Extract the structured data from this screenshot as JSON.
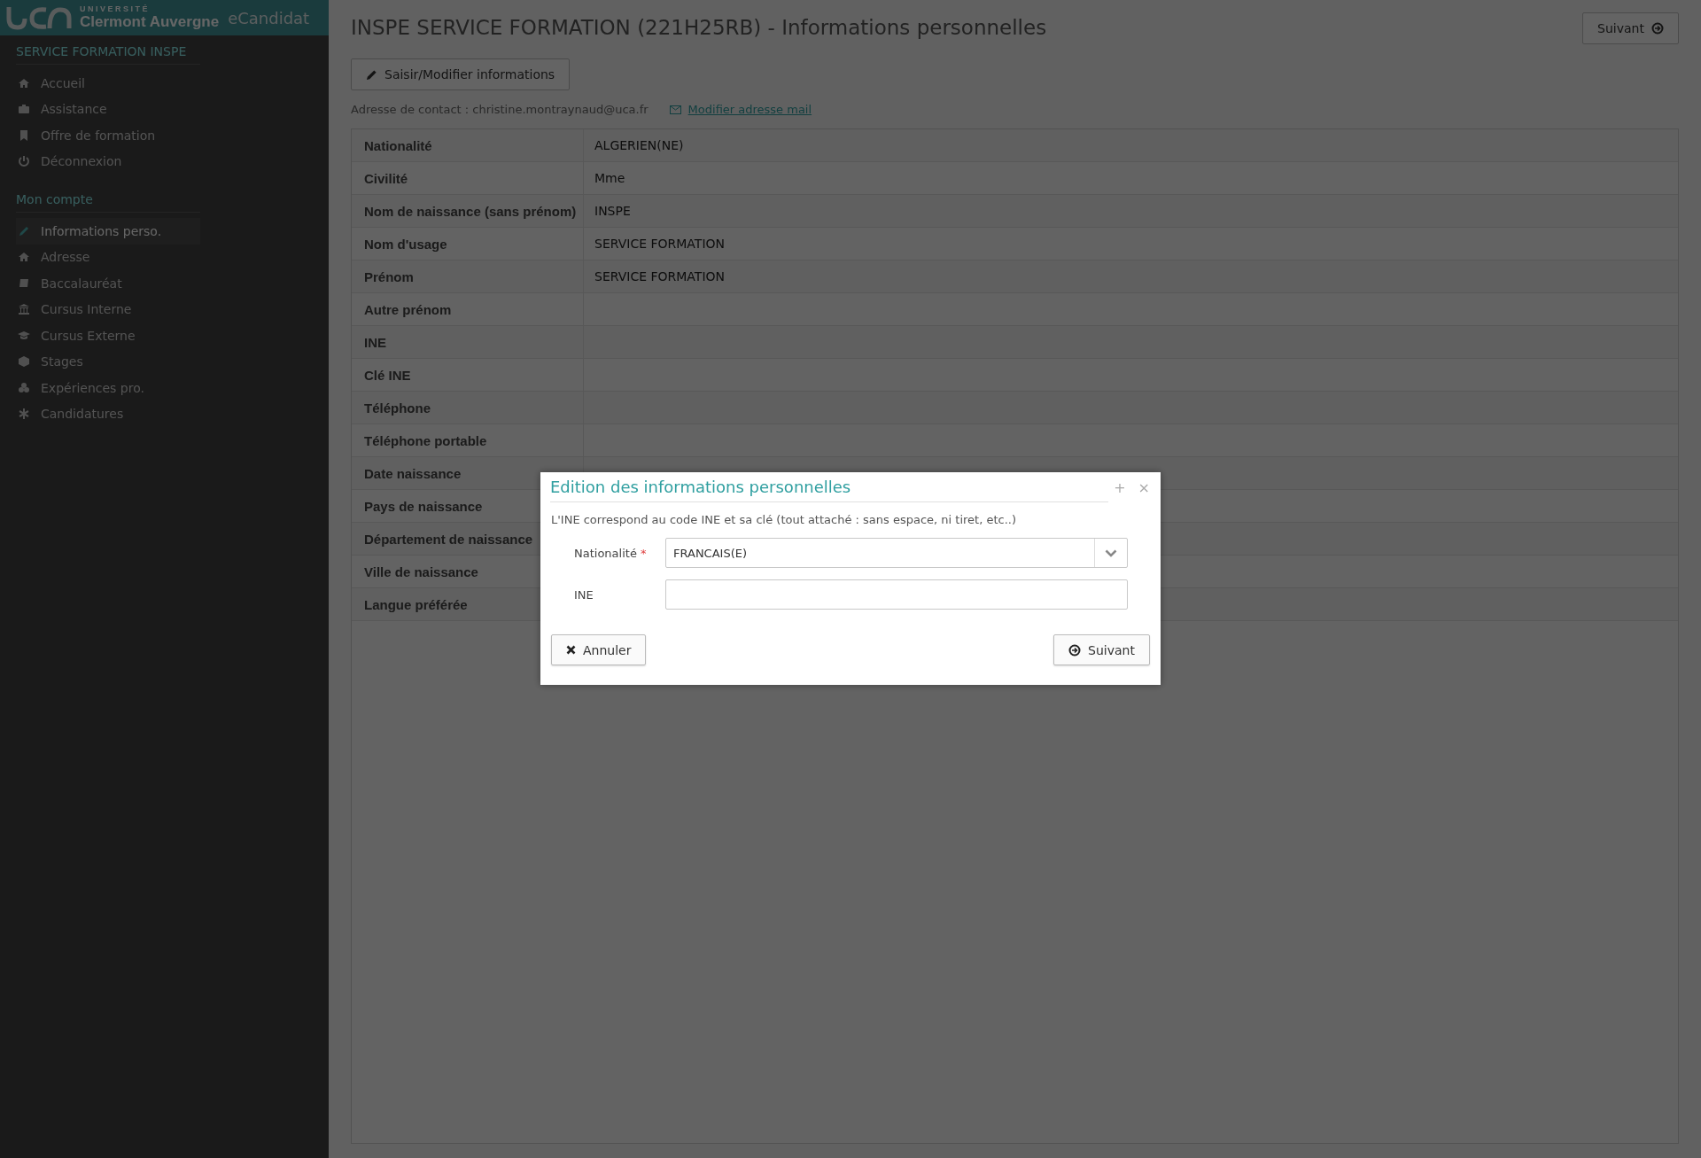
{
  "header": {
    "university_small": "UNIVERSITÉ",
    "university": "Clermont Auvergne",
    "app_name": "eCandidat"
  },
  "sidebar": {
    "sections": [
      {
        "title": "SERVICE FORMATION INSPE",
        "items": [
          {
            "label": "Accueil",
            "selected": false
          },
          {
            "label": "Assistance",
            "selected": false
          },
          {
            "label": "Offre de formation",
            "selected": false
          },
          {
            "label": "Déconnexion",
            "selected": false
          }
        ]
      },
      {
        "title": "Mon compte",
        "items": [
          {
            "label": "Informations perso.",
            "selected": true
          },
          {
            "label": "Adresse",
            "selected": false
          },
          {
            "label": "Baccalauréat",
            "selected": false
          },
          {
            "label": "Cursus Interne",
            "selected": false
          },
          {
            "label": "Cursus Externe",
            "selected": false
          },
          {
            "label": "Stages",
            "selected": false
          },
          {
            "label": "Expériences pro.",
            "selected": false
          },
          {
            "label": "Candidatures",
            "selected": false
          }
        ]
      }
    ]
  },
  "page": {
    "title": "INSPE SERVICE FORMATION (221H25RB) - Informations personnelles",
    "next_button": "Suivant",
    "edit_button": "Saisir/Modifier informations",
    "contact": "Adresse de contact : christine.montraynaud@uca.fr",
    "change_mail_link": "Modifier adresse mail"
  },
  "table": {
    "rows": [
      {
        "label": "Nationalité",
        "value": "ALGERIEN(NE)"
      },
      {
        "label": "Civilité",
        "value": "Mme"
      },
      {
        "label": "Nom de naissance (sans prénom)",
        "value": "INSPE"
      },
      {
        "label": "Nom d'usage",
        "value": "SERVICE FORMATION"
      },
      {
        "label": "Prénom",
        "value": "SERVICE FORMATION"
      },
      {
        "label": "Autre prénom"
      },
      {
        "label": "INE"
      },
      {
        "label": "Clé INE"
      },
      {
        "label": "Téléphone"
      },
      {
        "label": "Téléphone portable"
      },
      {
        "label": "Date naissance"
      },
      {
        "label": "Pays de naissance"
      },
      {
        "label": "Département de naissance"
      },
      {
        "label": "Ville de naissance"
      },
      {
        "label": "Langue préférée"
      }
    ]
  },
  "dialog": {
    "title": "Edition des informations personnelles",
    "maximize": "+",
    "close": "×",
    "hint": "L'INE correspond au code INE et sa clé (tout attaché : sans espace, ni tiret, etc..)",
    "fields": [
      {
        "kind": "select",
        "label": "Nationalité",
        "required": true,
        "value": "FRANCAIS(E)"
      },
      {
        "kind": "text",
        "label": "INE",
        "required": false
      }
    ],
    "required_mark": "*",
    "cancel_button": "Annuler",
    "next_button": "Suivant"
  }
}
